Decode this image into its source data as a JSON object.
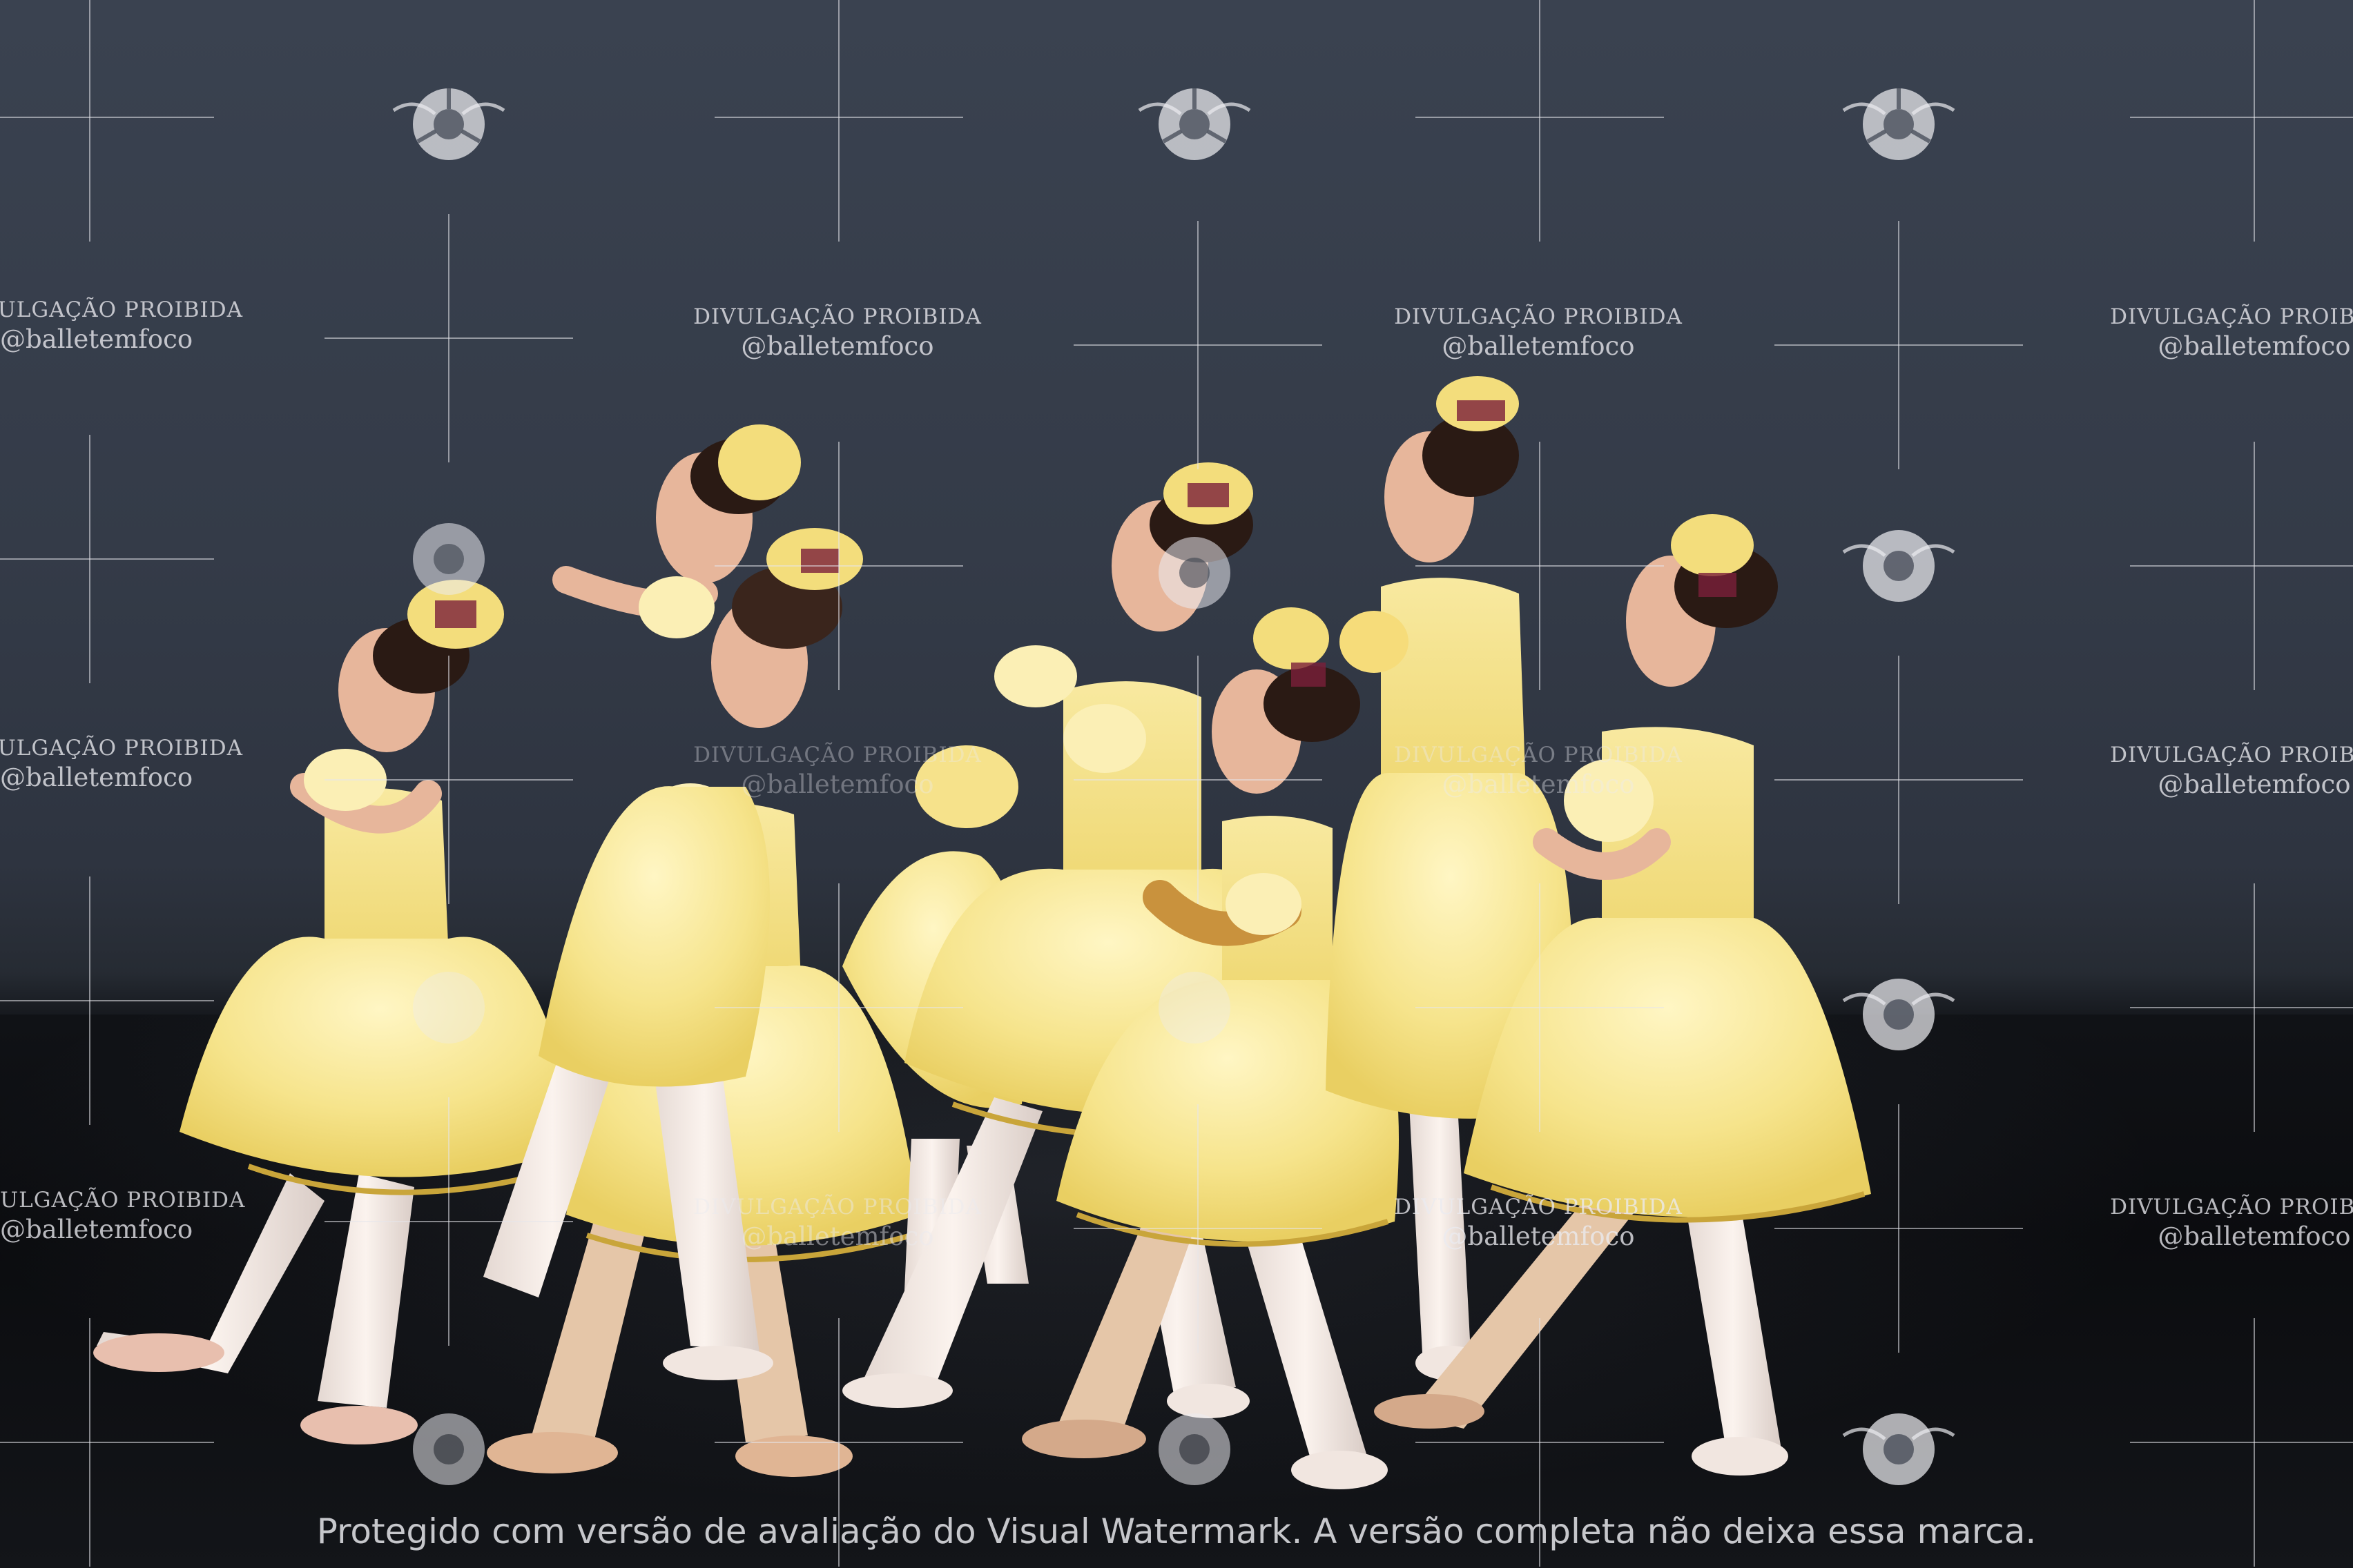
{
  "watermark": {
    "notice": "DIVULGAÇÃO PROIBIDA",
    "handle": "@balletemfoco",
    "notice_cropped": "ULGAÇÃO PROIBIDA",
    "notice_cropped_b": "IVULGAÇÃO PROIBIDA"
  },
  "caption": {
    "text": "Protegido com versão de avaliação do Visual Watermark. A versão completa não deixa essa marca."
  },
  "colors": {
    "backdrop": "#343b48",
    "floor": "#0b0c0f",
    "costume": "#f6e79a",
    "ribbon": "#7a1f3a",
    "tights": "#f1e6e0"
  },
  "icons": [
    "camera-aperture-logo"
  ]
}
